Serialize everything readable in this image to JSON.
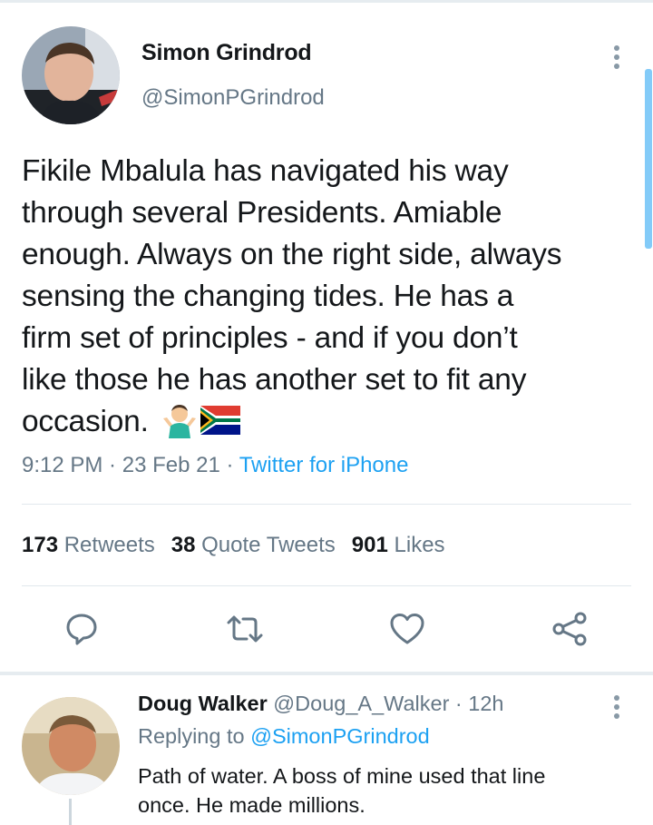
{
  "tweet": {
    "author_name": "Simon Grindrod",
    "author_handle": "@SimonPGrindrod",
    "text": "Fikile Mbalula has navigated his way\nthrough several Presidents. Amiable\nenough. Always on the right side, always\nsensing the changing tides. He has a\nfirm set of principles - and if you don’t\nlike those he has another set to fit any\noccasion.",
    "emojis": [
      "person-shrugging-icon",
      "south-africa-flag-icon"
    ],
    "time": "9:12 PM",
    "date": "23 Feb 21",
    "separator": " · ",
    "source": "Twitter for iPhone"
  },
  "stats": {
    "retweets_count": "173",
    "retweets_label": "Retweets",
    "quotes_count": "38",
    "quotes_label": "Quote Tweets",
    "likes_count": "901",
    "likes_label": "Likes"
  },
  "actions": [
    "reply-icon",
    "retweet-icon",
    "like-icon",
    "share-icon"
  ],
  "reply": {
    "author_name": "Doug Walker",
    "author_handle": "@Doug_A_Walker",
    "time_ago": "12h",
    "separator": " · ",
    "replying_prefix": "Replying to",
    "replying_to": "@SimonPGrindrod",
    "text": "Path of water. A boss of mine used that line\nonce. He made millions."
  },
  "colors": {
    "accent": "#1da1f2",
    "secondary_text": "#657786",
    "primary_text": "#14171a",
    "divider": "#e1e8ed"
  }
}
